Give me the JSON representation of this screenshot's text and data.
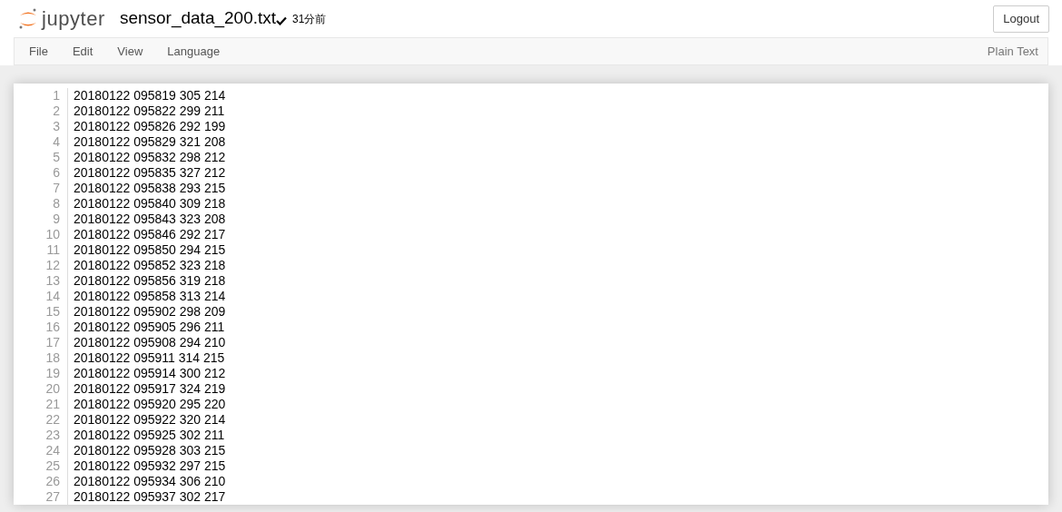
{
  "header": {
    "logo_text": "jupyter",
    "file_name": "sensor_data_200.txt",
    "saved": true,
    "last_saved": "31分前",
    "logout_button": "Logout"
  },
  "menu": {
    "items": [
      "File",
      "Edit",
      "View",
      "Language"
    ],
    "mode": "Plain Text"
  },
  "editor": {
    "lines": [
      {
        "number": "1",
        "text": "20180122 095819 305 214"
      },
      {
        "number": "2",
        "text": "20180122 095822 299 211"
      },
      {
        "number": "3",
        "text": "20180122 095826 292 199"
      },
      {
        "number": "4",
        "text": "20180122 095829 321 208"
      },
      {
        "number": "5",
        "text": "20180122 095832 298 212"
      },
      {
        "number": "6",
        "text": "20180122 095835 327 212"
      },
      {
        "number": "7",
        "text": "20180122 095838 293 215"
      },
      {
        "number": "8",
        "text": "20180122 095840 309 218"
      },
      {
        "number": "9",
        "text": "20180122 095843 323 208"
      },
      {
        "number": "10",
        "text": "20180122 095846 292 217"
      },
      {
        "number": "11",
        "text": "20180122 095850 294 215"
      },
      {
        "number": "12",
        "text": "20180122 095852 323 218"
      },
      {
        "number": "13",
        "text": "20180122 095856 319 218"
      },
      {
        "number": "14",
        "text": "20180122 095858 313 214"
      },
      {
        "number": "15",
        "text": "20180122 095902 298 209"
      },
      {
        "number": "16",
        "text": "20180122 095905 296 211"
      },
      {
        "number": "17",
        "text": "20180122 095908 294 210"
      },
      {
        "number": "18",
        "text": "20180122 095911 314 215"
      },
      {
        "number": "19",
        "text": "20180122 095914 300 212"
      },
      {
        "number": "20",
        "text": "20180122 095917 324 219"
      },
      {
        "number": "21",
        "text": "20180122 095920 295 220"
      },
      {
        "number": "22",
        "text": "20180122 095922 320 214"
      },
      {
        "number": "23",
        "text": "20180122 095925 302 211"
      },
      {
        "number": "24",
        "text": "20180122 095928 303 215"
      },
      {
        "number": "25",
        "text": "20180122 095932 297 215"
      },
      {
        "number": "26",
        "text": "20180122 095934 306 210"
      },
      {
        "number": "27",
        "text": "20180122 095937 302 217"
      }
    ]
  }
}
